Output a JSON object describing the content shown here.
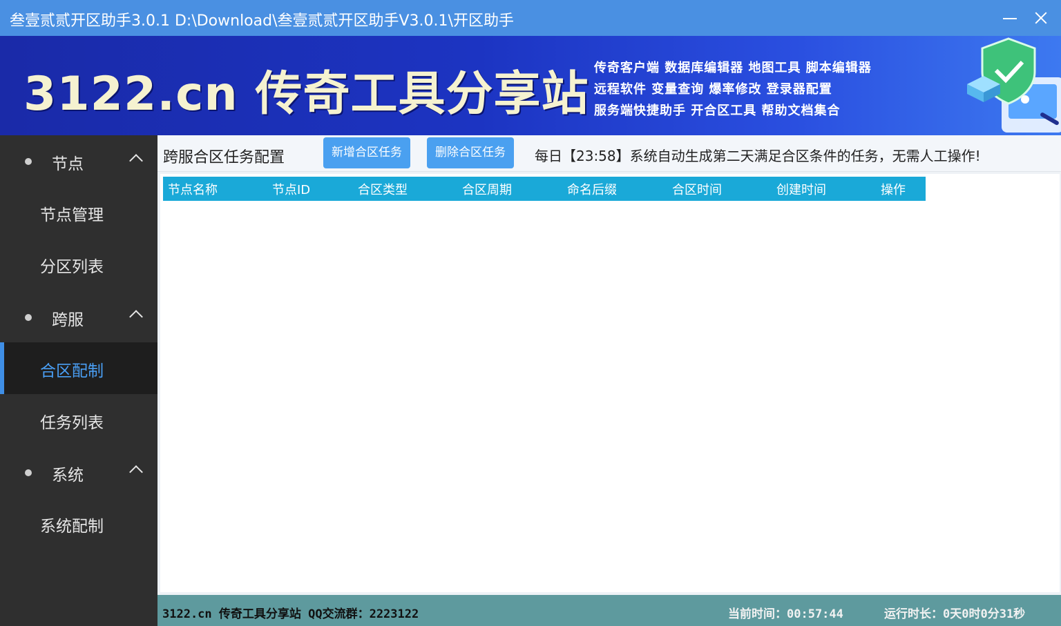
{
  "window": {
    "title": "叁壹贰贰开区助手3.0.1 D:\\Download\\叁壹贰贰开区助手V3.0.1\\开区助手"
  },
  "banner": {
    "logo_text": "3122.cn  传奇工具分享站",
    "features": [
      "传奇客户端 数据库编辑器 地图工具 脚本编辑器",
      "远程软件 变量查询 爆率修改 登录器配置",
      "服务端快捷助手 开合区工具 帮助文档集合"
    ]
  },
  "sidebar": {
    "groups": [
      {
        "label": "节点",
        "items": [
          "节点管理",
          "分区列表"
        ]
      },
      {
        "label": "跨服",
        "items": [
          "合区配制",
          "任务列表"
        ]
      },
      {
        "label": "系统",
        "items": [
          "系统配制"
        ]
      }
    ],
    "active_item": "合区配制"
  },
  "toolbar": {
    "heading": "跨服合区任务配置",
    "add_label": "新增合区任务",
    "delete_label": "删除合区任务",
    "notice": "每日【23:58】系统自动生成第二天满足合区条件的任务，无需人工操作!"
  },
  "table": {
    "columns": [
      "节点名称",
      "节点ID",
      "合区类型",
      "合区周期",
      "命名后缀",
      "合区时间",
      "创建时间",
      "操作"
    ],
    "rows": []
  },
  "status": {
    "left": "3122.cn 传奇工具分享站 QQ交流群：2223122",
    "current_time": "当前时间：00:57:44",
    "run_time": "运行时长：0天0时0分31秒"
  },
  "colors": {
    "titlebar": "#4a90e2",
    "sidebar_bg": "#2f2f2f",
    "accent": "#3f8fe6",
    "button": "#4aa0f0",
    "table_header": "#1aa9d8",
    "statusbar": "#5e9a9e"
  }
}
